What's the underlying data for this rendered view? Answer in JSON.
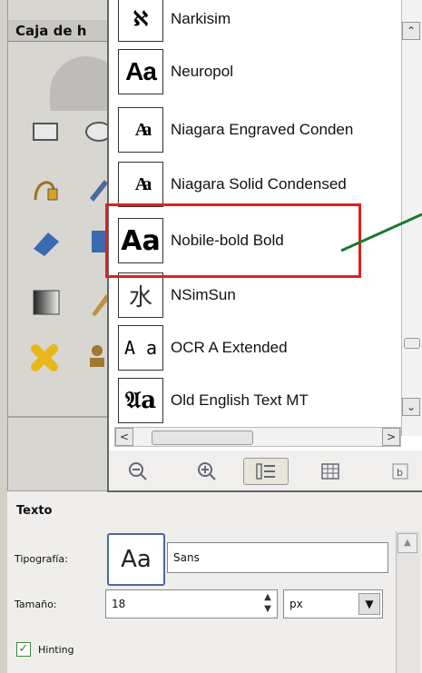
{
  "toolbox": {
    "title": "Caja de h",
    "tools": [
      "rect-select-icon",
      "ellipse-select-icon",
      "paths-icon",
      "pencil-icon",
      "clone-icon",
      "text-tool-icon",
      "blend-icon",
      "brush-icon",
      "heal-icon",
      "stamp-icon"
    ]
  },
  "font_popup": {
    "fonts": [
      {
        "name": "Narkisim",
        "sample": "ℵ"
      },
      {
        "name": "Neuropol",
        "sample": "Aa"
      },
      {
        "name": "Niagara Engraved Conden",
        "sample": "Aa"
      },
      {
        "name": "Niagara Solid Condensed",
        "sample": "Aa"
      },
      {
        "name": "Nobile-bold Bold",
        "sample": "Aa"
      },
      {
        "name": "NSimSun",
        "sample": "水"
      },
      {
        "name": "OCR A Extended",
        "sample": "A a"
      },
      {
        "name": "Old English Text MT",
        "sample": "𝔄a"
      }
    ],
    "highlighted_font": "Nobile-bold Bold",
    "toolbar_icons": [
      "zoom-out-icon",
      "zoom-in-icon",
      "list-view-icon",
      "grid-view-icon",
      "edit-icon"
    ]
  },
  "text_options": {
    "header": "Texto",
    "font_label": "Tipografía:",
    "font_preview": "Aa",
    "font_value": "Sans",
    "size_label": "Tamaño:",
    "size_value": "18",
    "unit_value": "px",
    "hinting_label": "Hinting",
    "hinting_checked": true
  },
  "colors": {
    "highlight": "#e02020",
    "arrow": "#1a7a2a"
  }
}
